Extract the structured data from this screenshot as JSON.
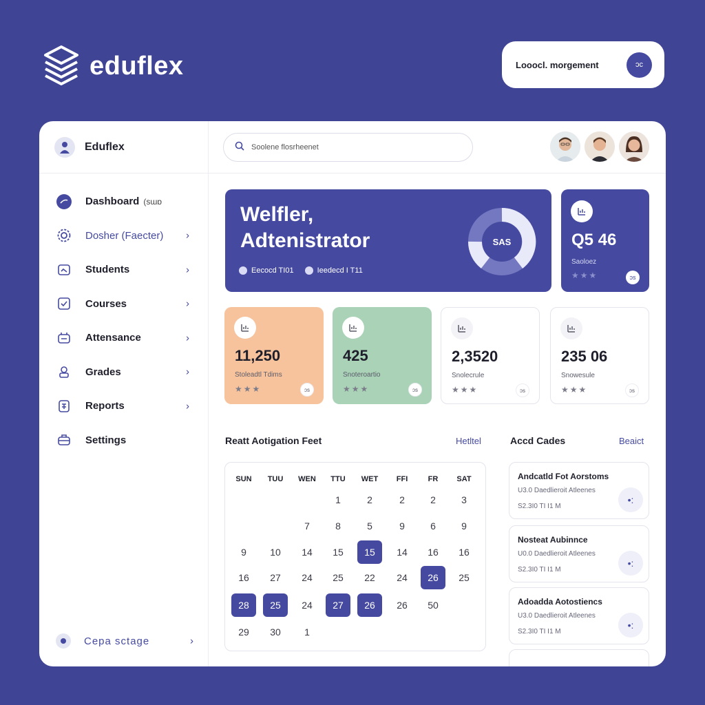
{
  "brand": {
    "name": "eduflex"
  },
  "top_pill": {
    "label": "Looocl. morgement",
    "button_label": "ɔc"
  },
  "sidebar": {
    "title": "Eduflex",
    "items": [
      {
        "label": "Dashboard",
        "badge": "(sɯɒ",
        "icon": "dashboard-icon",
        "chevron": false
      },
      {
        "label": "Dosher (Faecter)",
        "badge": "",
        "icon": "gear-icon",
        "chevron": true
      },
      {
        "label": "Students",
        "badge": "",
        "icon": "students-icon",
        "chevron": true
      },
      {
        "label": "Courses",
        "badge": "",
        "icon": "courses-icon",
        "chevron": true
      },
      {
        "label": "Attensance",
        "badge": "",
        "icon": "attendance-icon",
        "chevron": true
      },
      {
        "label": "Grades",
        "badge": "",
        "icon": "grades-icon",
        "chevron": true
      },
      {
        "label": "Reports",
        "badge": "",
        "icon": "reports-icon",
        "chevron": true
      },
      {
        "label": "Settings",
        "badge": "",
        "icon": "settings-icon",
        "chevron": false
      }
    ],
    "footer_label": "Cepa sctage",
    "chevron_glyph": "›"
  },
  "search": {
    "placeholder": "Soolene flosrheenet"
  },
  "welcome": {
    "line1": "Welfler,",
    "line2": "Adtenistrator",
    "donut_label": "SAS",
    "meta1": "Eecocd TI01",
    "meta2": "Ieedecd I T11"
  },
  "stat_small": {
    "value": "Q5 46",
    "label": "Saoloez",
    "stars": "★★★",
    "mini": "ɔs"
  },
  "stats": [
    {
      "value": "11,250",
      "label": "Stoleadtl Tdims",
      "stars": "★★★",
      "mini": "ɔs"
    },
    {
      "value": "425",
      "label": "Snoteroartio",
      "stars": "★★★",
      "mini": "ɔs"
    },
    {
      "value": "2,3520",
      "label": "Snolecrule",
      "stars": "★★★",
      "mini": "ɔs"
    },
    {
      "value": "235 06",
      "label": "Snowesule",
      "stars": "★★★",
      "mini": "ɔs"
    }
  ],
  "calendar": {
    "title": "Reatt Aotigation Feet",
    "link": "Hetltel",
    "headers": [
      "SUN",
      "TUU",
      "WEN",
      "TTU",
      "WET",
      "FFI",
      "FR",
      "SAT"
    ],
    "rows": [
      [
        "",
        "",
        "",
        "1",
        "2",
        "2",
        "2",
        "3"
      ],
      [
        "",
        "",
        "7",
        "8",
        "5",
        "9",
        "6",
        "9"
      ],
      [
        "9",
        "10",
        "14",
        "15",
        "15",
        "14",
        "16",
        "16"
      ],
      [
        "16",
        "27",
        "24",
        "25",
        "22",
        "24",
        "26",
        "25"
      ],
      [
        "28",
        "25",
        "24",
        "27",
        "26",
        "26",
        "50",
        ""
      ],
      [
        "29",
        "30",
        "1",
        "",
        "",
        "",
        "",
        ""
      ]
    ],
    "highlighted": [
      "2-4",
      "3-6",
      "4-0",
      "4-1",
      "4-3",
      "4-4"
    ]
  },
  "list": {
    "title": "Accd Cades",
    "link": "Beaict",
    "items": [
      {
        "title": "Andcatld Fot Aorstoms",
        "line1": "U3.0 Daedlieroit Atleenes",
        "line2": "S2.3I0 TI I1 M",
        "button": "•:"
      },
      {
        "title": "Nosteat Aubinnce",
        "line1": "U0.0 Daedlieroit Atleenes",
        "line2": "S2.3I0 TI I1 M",
        "button": "•:"
      },
      {
        "title": "Adoadda Aotostiencs",
        "line1": "U3.0 Daedlieroit Atleenes",
        "line2": "S2.3I0 TI I1 M",
        "button": "•:"
      }
    ]
  },
  "colors": {
    "background": "#3f4495",
    "accent": "#454aa0",
    "orange": "#f7c39c",
    "green": "#a9d2b7"
  }
}
